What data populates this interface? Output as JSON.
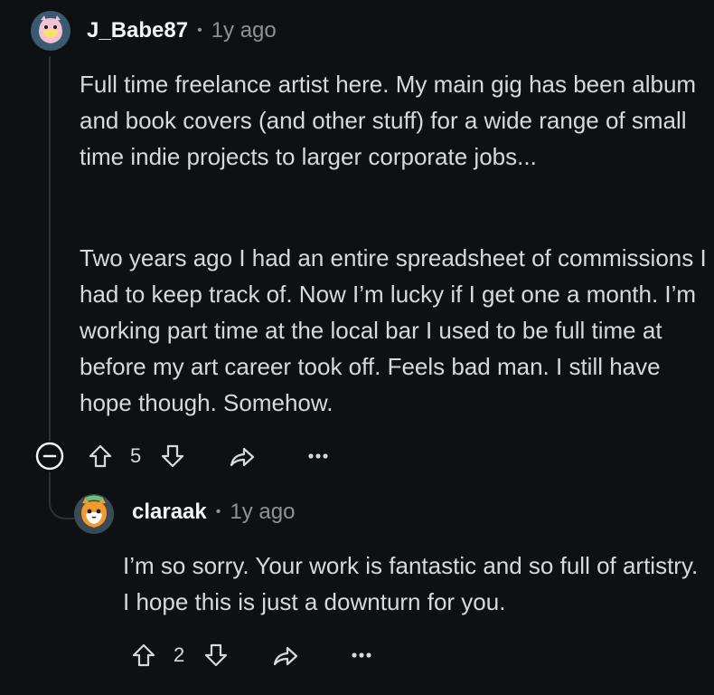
{
  "comment": {
    "username": "J_Babe87",
    "time": "1y ago",
    "paragraph1": "Full time freelance artist here. My main gig has been album and book covers (and other stuff) for a wide range of small time indie projects to larger corporate jobs...",
    "paragraph2": "Two years ago I had an entire spreadsheet of commissions I had to keep track of. Now I’m lucky if I get one a month. I’m working part time at the local bar I used to be full time at before my art career took off. Feels bad man. I still have hope though. Somehow.",
    "votes": "5"
  },
  "reply": {
    "username": "claraak",
    "time": "1y ago",
    "text": "I’m so sorry. Your work is fantastic and so full of artistry. I hope this is just a downturn for you.",
    "votes": "2"
  },
  "separator": "•",
  "icons": {
    "collapse": "collapse-icon",
    "upvote": "upvote-icon",
    "downvote": "downvote-icon",
    "share": "share-icon",
    "more": "more-icon"
  },
  "colors": {
    "background": "#0e1113",
    "text": "#d7dadc",
    "muted": "#8b9398"
  }
}
